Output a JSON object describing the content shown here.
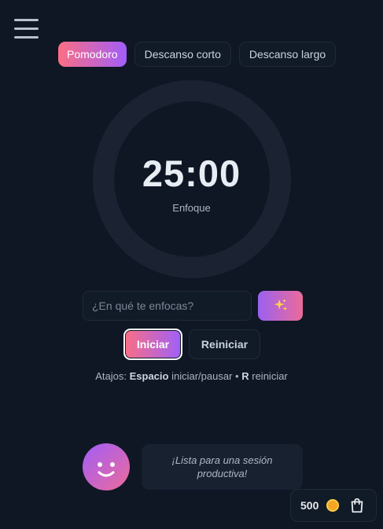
{
  "tabs": [
    {
      "label": "Pomodoro",
      "active": true
    },
    {
      "label": "Descanso corto",
      "active": false
    },
    {
      "label": "Descanso largo",
      "active": false
    }
  ],
  "timer": {
    "time": "25:00",
    "label": "Enfoque"
  },
  "focus": {
    "placeholder": "¿En qué te enfocas?",
    "sparkle_icon": "sparkles-icon"
  },
  "controls": {
    "start_label": "Iniciar",
    "reset_label": "Reiniciar"
  },
  "shortcuts": {
    "prefix": "Atajos:",
    "key1": "Espacio",
    "action1": "iniciar/pausar",
    "separator": "•",
    "key2": "R",
    "action2": "reiniciar"
  },
  "companion": {
    "message": "¡Lista para una sesión productiva!"
  },
  "wallet": {
    "coins": "500",
    "coin_icon": "coin-icon",
    "shop_icon": "shopping-bag-icon"
  },
  "colors": {
    "accent_pink": "#fb6f84",
    "accent_purple": "#a25df8",
    "background": "#0f1724"
  }
}
